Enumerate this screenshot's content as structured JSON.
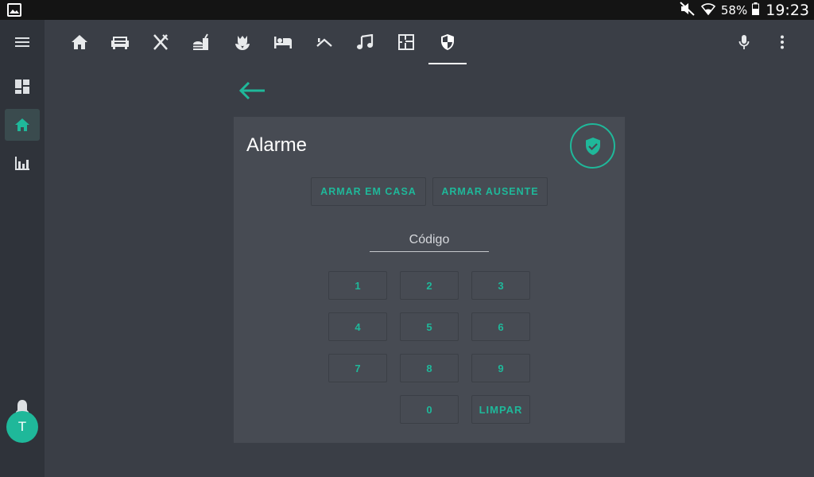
{
  "status_bar": {
    "battery_percent": "58%",
    "time": "19:23"
  },
  "top_tabs": [
    {
      "name": "home-icon",
      "active": false
    },
    {
      "name": "sofa-icon",
      "active": false
    },
    {
      "name": "silverware-icon",
      "active": false
    },
    {
      "name": "food-drink-icon",
      "active": false
    },
    {
      "name": "flower-icon",
      "active": false
    },
    {
      "name": "bed-icon",
      "active": false
    },
    {
      "name": "roof-icon",
      "active": false
    },
    {
      "name": "music-note-icon",
      "active": false
    },
    {
      "name": "floor-plan-icon",
      "active": false
    },
    {
      "name": "security-shield-icon",
      "active": true
    }
  ],
  "user": {
    "initial": "T"
  },
  "alarm_card": {
    "title": "Alarme",
    "arm_home_label": "ARMAR EM CASA",
    "arm_away_label": "ARMAR AUSENTE",
    "code_placeholder": "Código",
    "keys": [
      "1",
      "2",
      "3",
      "4",
      "5",
      "6",
      "7",
      "8",
      "9",
      "0"
    ],
    "clear_label": "LIMPAR"
  },
  "colors": {
    "accent": "#1fb89a",
    "card": "#474b53",
    "background": "#3a3e46",
    "sidebar": "#2f333a"
  }
}
